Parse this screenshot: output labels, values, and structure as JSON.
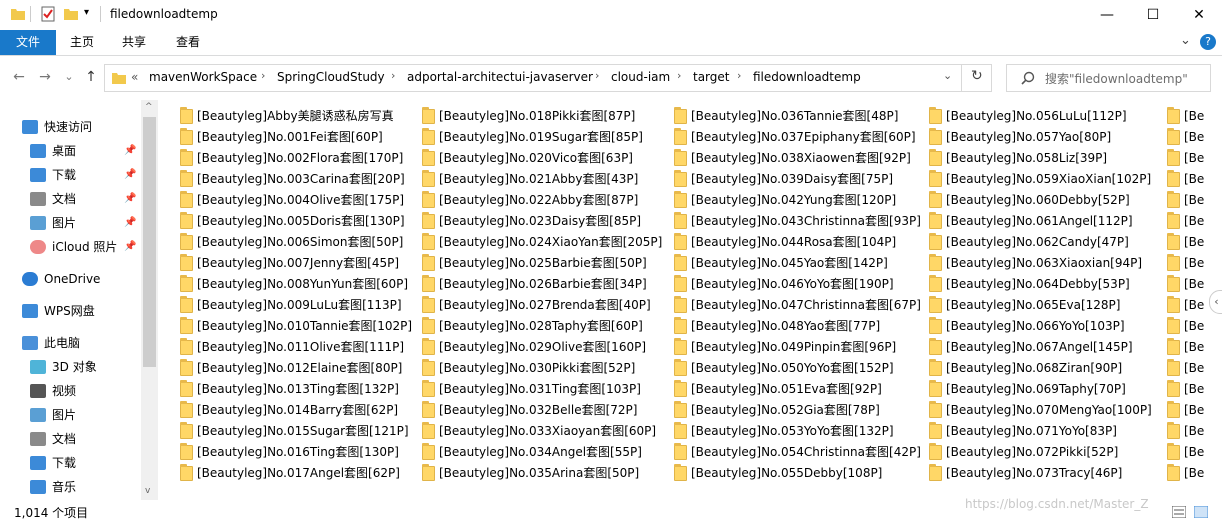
{
  "window": {
    "title": "filedownloadtemp",
    "quick_access_dropdown": "▾",
    "minimize": "—",
    "maximize": "☐",
    "close": "✕",
    "accent": "#1979ca"
  },
  "ribbon": {
    "tabs": [
      "文件",
      "主页",
      "共享",
      "查看"
    ],
    "expand": "⌄",
    "help": "?"
  },
  "nav": {
    "back": "←",
    "forward": "→",
    "recent": "⌄",
    "up": "↑",
    "overflow": "«",
    "breadcrumbs": [
      "mavenWorkSpace",
      "SpringCloudStudy",
      "adportal-architectui-javaserver",
      "cloud-iam",
      "target",
      "filedownloadtemp"
    ],
    "crumb_sep": "›",
    "history_dropdown": "⌄",
    "refresh": "↻",
    "search_placeholder": "搜索\"filedownloadtemp\""
  },
  "sidebar": {
    "items": [
      {
        "label": "快速访问",
        "icon": "star-icon",
        "pinned": false
      },
      {
        "label": "桌面",
        "icon": "desktop-icon",
        "pinned": true
      },
      {
        "label": "下载",
        "icon": "download-icon",
        "pinned": true
      },
      {
        "label": "文档",
        "icon": "document-icon",
        "pinned": true
      },
      {
        "label": "图片",
        "icon": "picture-icon",
        "pinned": true
      },
      {
        "label": "iCloud 照片",
        "icon": "icloud-photos-icon",
        "pinned": true
      },
      {
        "label": "OneDrive",
        "icon": "cloud-icon",
        "pinned": false
      },
      {
        "label": "WPS网盘",
        "icon": "wps-cloud-icon",
        "pinned": false
      },
      {
        "label": "此电脑",
        "icon": "computer-icon",
        "pinned": false
      },
      {
        "label": "3D 对象",
        "icon": "3d-objects-icon",
        "pinned": false
      },
      {
        "label": "视频",
        "icon": "video-icon",
        "pinned": false
      },
      {
        "label": "图片",
        "icon": "picture-icon",
        "pinned": false
      },
      {
        "label": "文档",
        "icon": "document-icon",
        "pinned": false
      },
      {
        "label": "下载",
        "icon": "download-icon",
        "pinned": false
      },
      {
        "label": "音乐",
        "icon": "music-icon",
        "pinned": false
      }
    ],
    "pin_glyph": "📌",
    "scroll_up": "^",
    "scroll_down": "v"
  },
  "files": {
    "columns": [
      [
        "[Beautyleg]Abby美腿诱惑私房写真",
        "[Beautyleg]No.001Fei套图[60P]",
        "[Beautyleg]No.002Flora套图[170P]",
        "[Beautyleg]No.003Carina套图[20P]",
        "[Beautyleg]No.004Olive套图[175P]",
        "[Beautyleg]No.005Doris套图[130P]",
        "[Beautyleg]No.006Simon套图[50P]",
        "[Beautyleg]No.007Jenny套图[45P]",
        "[Beautyleg]No.008YunYun套图[60P]",
        "[Beautyleg]No.009LuLu套图[113P]",
        "[Beautyleg]No.010Tannie套图[102P]",
        "[Beautyleg]No.011Olive套图[111P]",
        "[Beautyleg]No.012Elaine套图[80P]",
        "[Beautyleg]No.013Ting套图[132P]",
        "[Beautyleg]No.014Barry套图[62P]",
        "[Beautyleg]No.015Sugar套图[121P]",
        "[Beautyleg]No.016Ting套图[130P]",
        "[Beautyleg]No.017Angel套图[62P]"
      ],
      [
        "[Beautyleg]No.018Pikki套图[87P]",
        "[Beautyleg]No.019Sugar套图[85P]",
        "[Beautyleg]No.020Vico套图[63P]",
        "[Beautyleg]No.021Abby套图[43P]",
        "[Beautyleg]No.022Abby套图[87P]",
        "[Beautyleg]No.023Daisy套图[85P]",
        "[Beautyleg]No.024XiaoYan套图[205P]",
        "[Beautyleg]No.025Barbie套图[50P]",
        "[Beautyleg]No.026Barbie套图[34P]",
        "[Beautyleg]No.027Brenda套图[40P]",
        "[Beautyleg]No.028Taphy套图[60P]",
        "[Beautyleg]No.029Olive套图[160P]",
        "[Beautyleg]No.030Pikki套图[52P]",
        "[Beautyleg]No.031Ting套图[103P]",
        "[Beautyleg]No.032Belle套图[72P]",
        "[Beautyleg]No.033Xiaoyan套图[60P]",
        "[Beautyleg]No.034Angel套图[55P]",
        "[Beautyleg]No.035Arina套图[50P]"
      ],
      [
        "[Beautyleg]No.036Tannie套图[48P]",
        "[Beautyleg]No.037Epiphany套图[60P]",
        "[Beautyleg]No.038Xiaowen套图[92P]",
        "[Beautyleg]No.039Daisy套图[75P]",
        "[Beautyleg]No.042Yung套图[120P]",
        "[Beautyleg]No.043Christinna套图[93P]",
        "[Beautyleg]No.044Rosa套图[104P]",
        "[Beautyleg]No.045Yao套图[142P]",
        "[Beautyleg]No.046YoYo套图[190P]",
        "[Beautyleg]No.047Christinna套图[67P]",
        "[Beautyleg]No.048Yao套图[77P]",
        "[Beautyleg]No.049Pinpin套图[96P]",
        "[Beautyleg]No.050YoYo套图[152P]",
        "[Beautyleg]No.051Eva套图[92P]",
        "[Beautyleg]No.052Gia套图[78P]",
        "[Beautyleg]No.053YoYo套图[132P]",
        "[Beautyleg]No.054Christinna套图[42P]",
        "[Beautyleg]No.055Debby[108P]"
      ],
      [
        "[Beautyleg]No.056LuLu[112P]",
        "[Beautyleg]No.057Yao[80P]",
        "[Beautyleg]No.058Liz[39P]",
        "[Beautyleg]No.059XiaoXian[102P]",
        "[Beautyleg]No.060Debby[52P]",
        "[Beautyleg]No.061Angel[112P]",
        "[Beautyleg]No.062Candy[47P]",
        "[Beautyleg]No.063Xiaoxian[94P]",
        "[Beautyleg]No.064Debby[53P]",
        "[Beautyleg]No.065Eva[128P]",
        "[Beautyleg]No.066YoYo[103P]",
        "[Beautyleg]No.067Angel[145P]",
        "[Beautyleg]No.068Ziran[90P]",
        "[Beautyleg]No.069Taphy[70P]",
        "[Beautyleg]No.070MengYao[100P]",
        "[Beautyleg]No.071YoYo[83P]",
        "[Beautyleg]No.072Pikki[52P]",
        "[Beautyleg]No.073Tracy[46P]"
      ],
      [
        "[Be",
        "[Be",
        "[Be",
        "[Be",
        "[Be",
        "[Be",
        "[Be",
        "[Be",
        "[Be",
        "[Be",
        "[Be",
        "[Be",
        "[Be",
        "[Be",
        "[Be",
        "[Be",
        "[Be",
        "[Be"
      ]
    ]
  },
  "status": {
    "item_count": "1,014 个项目",
    "watermark": "https://blog.csdn.net/Master_Z"
  },
  "side_panel_toggle": "‹"
}
